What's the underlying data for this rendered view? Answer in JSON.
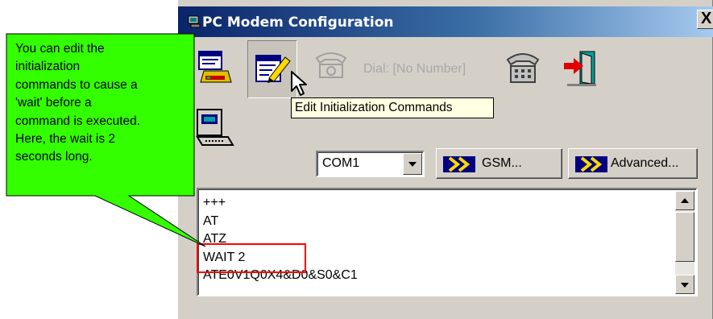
{
  "window": {
    "title": "PC Modem Configuration",
    "close_glyph": "X"
  },
  "toolbar": {
    "buttons": [
      {
        "icon": "modem-settings-icon"
      },
      {
        "icon": "edit-commands-icon"
      },
      {
        "icon": "dial-phone-icon"
      },
      {
        "icon": "telephone-icon"
      },
      {
        "icon": "exit-door-icon"
      }
    ],
    "dial_label": "Dial: [No Number]",
    "tooltip": "Edit Initialization Commands"
  },
  "port": {
    "selected": "COM1",
    "gsm_label": "GSM...",
    "advanced_label": "Advanced..."
  },
  "commands": {
    "lines": [
      "+++",
      "AT",
      "ATZ",
      "WAIT 2",
      "ATE0V1Q0X4&D0&S0&C1"
    ],
    "highlight_color": "#ff0000"
  },
  "callout": {
    "lines": [
      "You can edit the",
      "initialization",
      "commands to cause  a",
      "'wait' before a",
      "command is executed.",
      "Here, the wait is  2",
      "seconds long."
    ],
    "fill_color": "#33ff00"
  },
  "colors": {
    "titlebar_start": "#0a246a",
    "titlebar_end": "#a6caf0",
    "dialog_face": "#d4d0c8",
    "tooltip_bg": "#ffffe1"
  }
}
